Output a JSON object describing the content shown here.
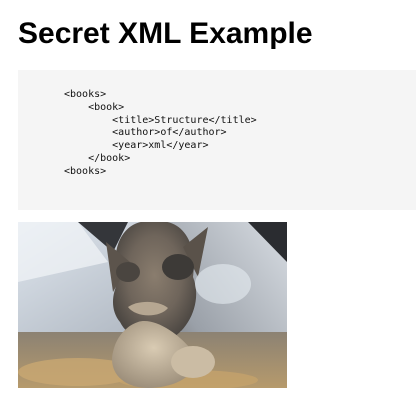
{
  "page": {
    "title": "Secret XML Example"
  },
  "code_block": {
    "lines": [
      "<books>",
      "    <book>",
      "        <title>Structure</title>",
      "        <author>of</author>",
      "        <year>xml</year>",
      "    </book>",
      "<books>"
    ]
  },
  "image": {
    "subject": "kitten-photo"
  }
}
